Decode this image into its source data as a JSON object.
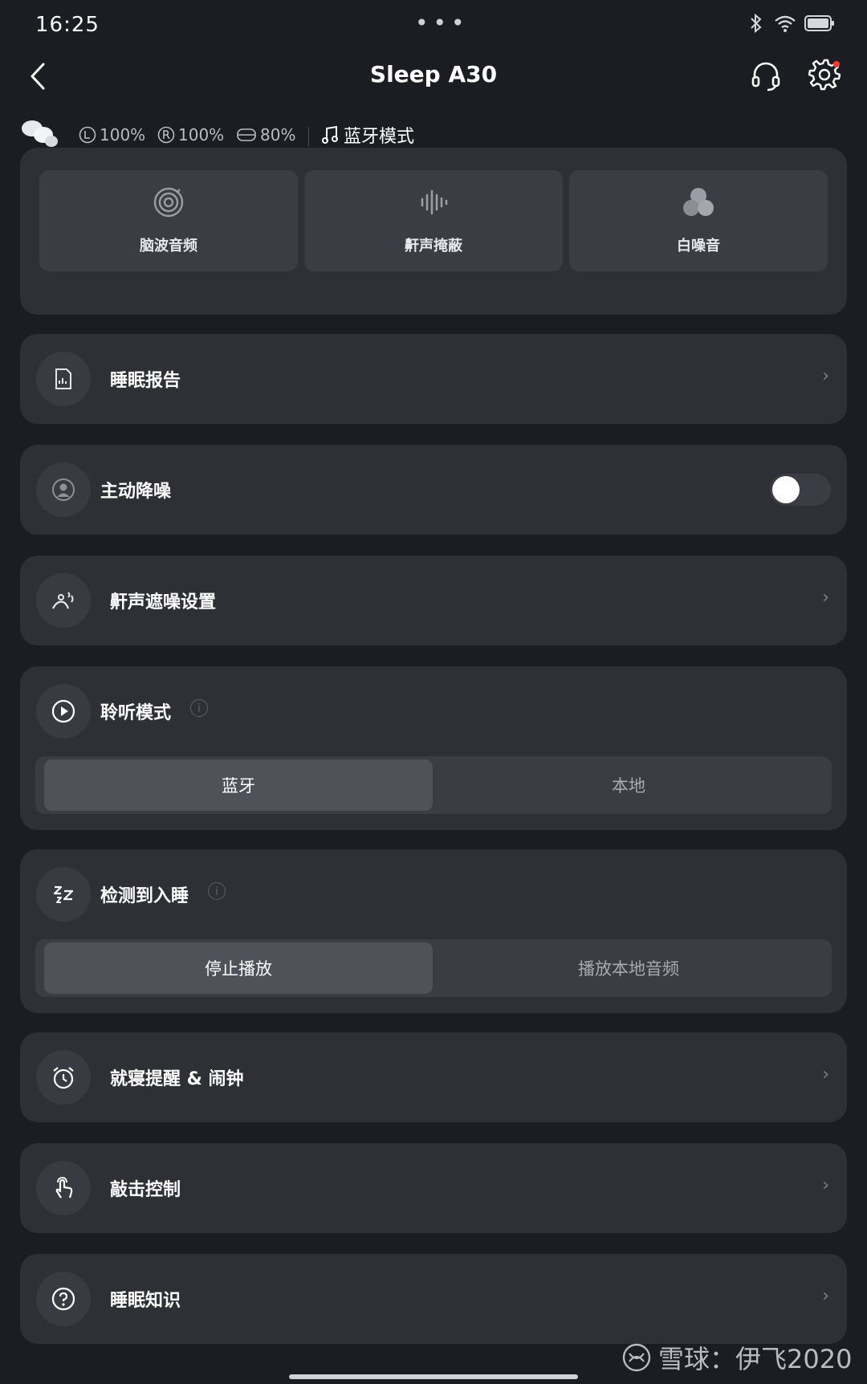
{
  "status_bar": {
    "time": "16:25",
    "dots": "•••"
  },
  "nav": {
    "title": "Sleep A30"
  },
  "device": {
    "left_battery": "100%",
    "right_battery": "100%",
    "case_battery": "80%",
    "mode": "蓝牙模式"
  },
  "sound_tiles": [
    {
      "label": "脑波音频",
      "icon": "brainwave-icon"
    },
    {
      "label": "鼾声掩蔽",
      "icon": "waveform-icon"
    },
    {
      "label": "白噪音",
      "icon": "circles-icon"
    }
  ],
  "sleep_report": {
    "label": "睡眠报告",
    "icon": "report-icon"
  },
  "anc": {
    "label": "主动降噪",
    "icon": "anc-icon",
    "enabled": false
  },
  "snore_settings": {
    "label": "鼾声遮噪设置",
    "icon": "snore-icon"
  },
  "listen_mode": {
    "label": "聆听模式",
    "icon": "play-icon",
    "options": [
      "蓝牙",
      "本地"
    ],
    "selected": "蓝牙"
  },
  "sleep_detect": {
    "label": "检测到入睡",
    "icon": "zzz-icon",
    "options": [
      "停止播放",
      "播放本地音频"
    ],
    "selected": "停止播放"
  },
  "bedtime_alarm": {
    "label": "就寝提醒 & 闹钟",
    "icon": "alarm-icon"
  },
  "tap_control": {
    "label": "敲击控制",
    "icon": "tap-icon"
  },
  "sleep_knowledge": {
    "label": "睡眠知识",
    "icon": "question-icon"
  },
  "watermark": {
    "text": "雪球：伊飞2020"
  },
  "colors": {
    "background": "#1c1d22",
    "card": "#2f3036",
    "tile": "#3c3d44",
    "selected_segment": "#50525a",
    "notification_dot": "#ff3b30"
  }
}
